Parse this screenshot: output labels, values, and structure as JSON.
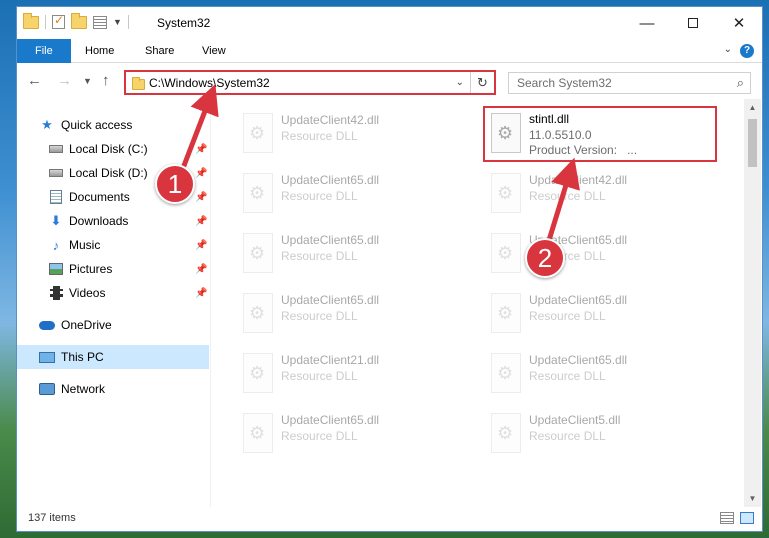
{
  "window": {
    "title": "System32"
  },
  "ribbon": {
    "tabs": [
      "File",
      "Home",
      "Share",
      "View"
    ]
  },
  "address": {
    "path": "C:\\Windows\\System32"
  },
  "search": {
    "placeholder": "Search System32"
  },
  "sidebar": {
    "quick_access": "Quick access",
    "items": [
      {
        "label": "Local Disk (C:)",
        "icon": "drive-icon",
        "pinned": true
      },
      {
        "label": "Local Disk (D:)",
        "icon": "drive-icon",
        "pinned": true
      },
      {
        "label": "Documents",
        "icon": "documents-icon",
        "pinned": true
      },
      {
        "label": "Downloads",
        "icon": "downloads-icon",
        "pinned": true
      },
      {
        "label": "Music",
        "icon": "music-icon",
        "pinned": true
      },
      {
        "label": "Pictures",
        "icon": "pictures-icon",
        "pinned": true
      },
      {
        "label": "Videos",
        "icon": "videos-icon",
        "pinned": true
      }
    ],
    "onedrive": "OneDrive",
    "this_pc": "This PC",
    "network": "Network"
  },
  "files": {
    "left_column": [
      {
        "name": "UpdateClient42.dll",
        "type": "Resource DLL"
      },
      {
        "name": "UpdateClient65.dll",
        "type": "Resource DLL"
      },
      {
        "name": "UpdateClient65.dll",
        "type": "Resource DLL"
      },
      {
        "name": "UpdateClient65.dll",
        "type": "Resource DLL"
      },
      {
        "name": "UpdateClient21.dll",
        "type": "Resource DLL"
      },
      {
        "name": "UpdateClient65.dll",
        "type": "Resource DLL"
      }
    ],
    "highlighted": {
      "name": "stintl.dll",
      "version": "11.0.5510.0",
      "product_label": "Product Version:",
      "product_value": "..."
    },
    "right_column": [
      {
        "name": "UpdateClient42.dll",
        "type": "Resource DLL"
      },
      {
        "name": "UpdateClient65.dll",
        "type": "Resource DLL"
      },
      {
        "name": "UpdateClient65.dll",
        "type": "Resource DLL"
      },
      {
        "name": "UpdateClient65.dll",
        "type": "Resource DLL"
      },
      {
        "name": "UpdateClient5.dll",
        "type": "Resource DLL"
      }
    ]
  },
  "status": {
    "item_count": "137 items"
  },
  "callouts": {
    "one": "1",
    "two": "2"
  },
  "colors": {
    "accent": "#1979ca",
    "highlight": "#d9353f",
    "selected": "#cce8ff"
  }
}
